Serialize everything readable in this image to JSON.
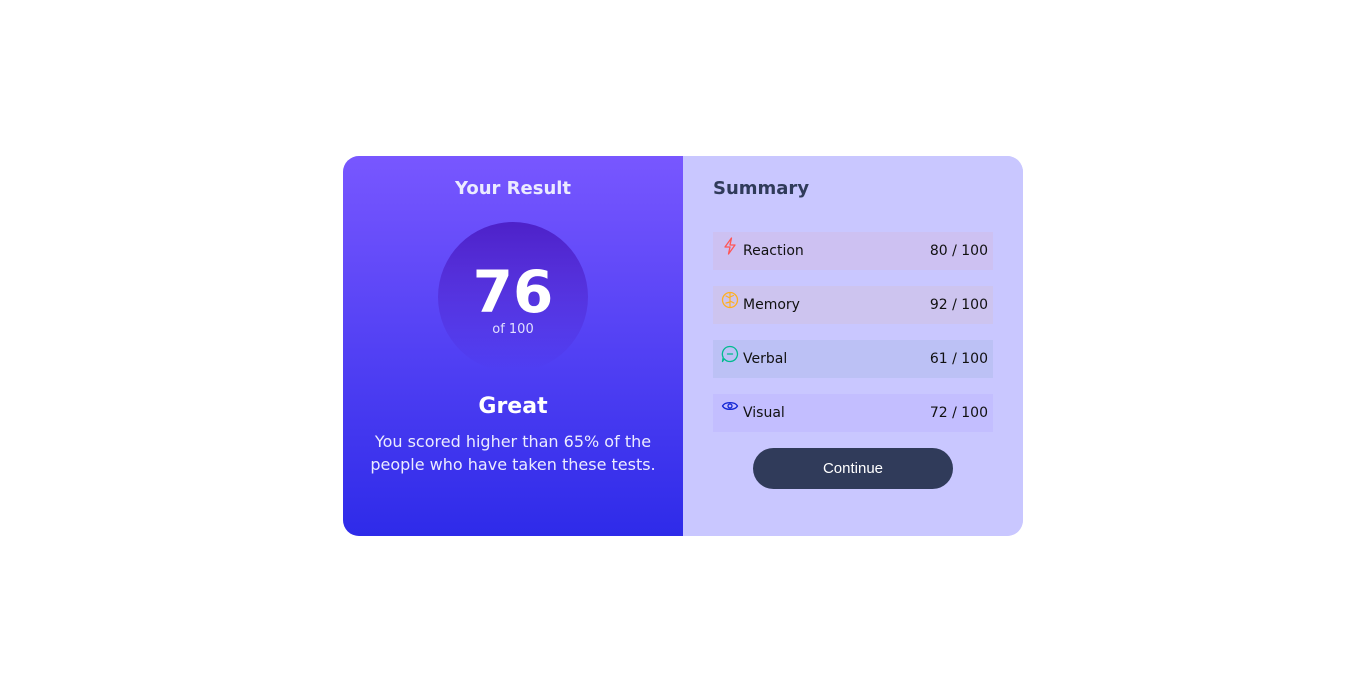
{
  "result": {
    "title": "Your Result",
    "score": "76",
    "score_of": "of 100",
    "rating": "Great",
    "description": "You scored higher than 65% of the people who have taken these tests."
  },
  "summary": {
    "title": "Summary",
    "items": [
      {
        "label": "Reaction",
        "score": "80 / 100",
        "icon": "lightning-icon",
        "color": "#ff5555"
      },
      {
        "label": "Memory",
        "score": "92 / 100",
        "icon": "brain-icon",
        "color": "#ffb01f"
      },
      {
        "label": "Verbal",
        "score": "61 / 100",
        "icon": "chat-bubble-icon",
        "color": "#00bb8f"
      },
      {
        "label": "Visual",
        "score": "72 / 100",
        "icon": "eye-icon",
        "color": "#1125d4"
      }
    ],
    "continue_label": "Continue"
  }
}
